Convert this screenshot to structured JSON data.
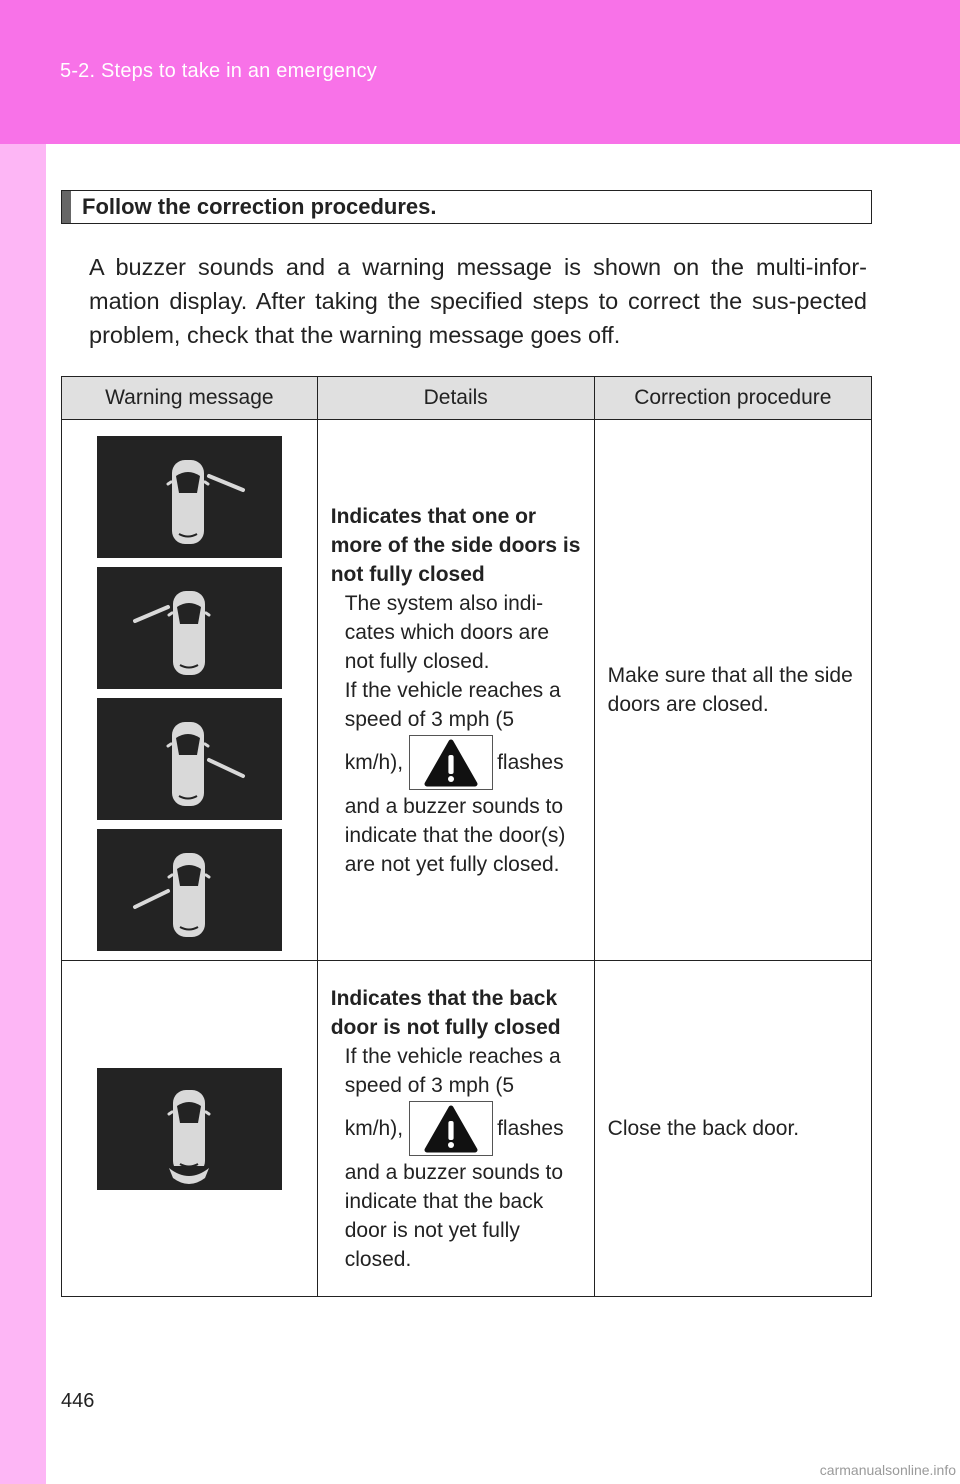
{
  "header": {
    "breadcrumb": "5-2. Steps to take in an emergency"
  },
  "section": {
    "title": "Follow the correction procedures.",
    "intro": "A buzzer sounds and a warning message is shown on the multi-infor-mation display. After taking the specified steps to correct the sus-pected problem, check that the warning message goes off."
  },
  "table": {
    "headers": [
      "Warning message",
      "Details",
      "Correction procedure"
    ],
    "rows": [
      {
        "images": [
          "side-door-front-right-open-display",
          "side-door-front-left-open-display",
          "side-door-rear-right-open-display",
          "side-door-rear-left-open-display"
        ],
        "detail_title": "Indicates that one or more of the side doors is not fully closed",
        "detail_text_1": "The system also indi-cates which doors are not fully closed.",
        "detail_text_2": "If the vehicle reaches a speed of 3 mph (5",
        "detail_pre_icon": "km/h),",
        "detail_post_icon": "flashes",
        "detail_text_3": "and a buzzer sounds to indicate that the door(s) are not yet fully closed.",
        "correction": "Make sure that all the side doors are closed."
      },
      {
        "images": [
          "back-door-open-display"
        ],
        "detail_title": "Indicates that the back door is not fully closed",
        "detail_text_2": "If the vehicle reaches a speed of 3 mph (5",
        "detail_pre_icon": "km/h),",
        "detail_post_icon": "flashes",
        "detail_text_3": "and a buzzer sounds to indicate that the back door is not yet fully closed.",
        "correction": "Close the back door."
      }
    ]
  },
  "footer": {
    "page_number": "446"
  },
  "watermark": "carmanualsonline.info",
  "colors": {
    "header": "#f872e8",
    "side_band": "#fdb6f5",
    "display_bg": "#232323",
    "table_header_bg": "#e0e0e0"
  }
}
